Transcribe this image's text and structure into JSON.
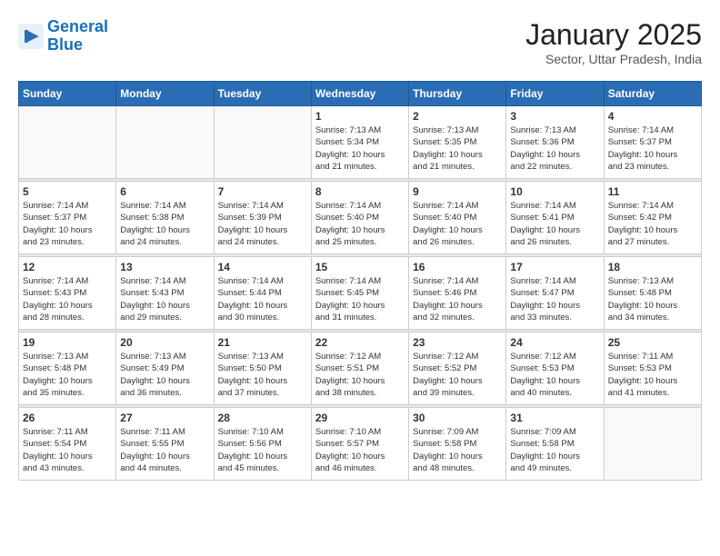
{
  "header": {
    "logo_line1": "General",
    "logo_line2": "Blue",
    "month": "January 2025",
    "location": "Sector, Uttar Pradesh, India"
  },
  "days_of_week": [
    "Sunday",
    "Monday",
    "Tuesday",
    "Wednesday",
    "Thursday",
    "Friday",
    "Saturday"
  ],
  "weeks": [
    [
      {
        "day": "",
        "info": ""
      },
      {
        "day": "",
        "info": ""
      },
      {
        "day": "",
        "info": ""
      },
      {
        "day": "1",
        "info": "Sunrise: 7:13 AM\nSunset: 5:34 PM\nDaylight: 10 hours\nand 21 minutes."
      },
      {
        "day": "2",
        "info": "Sunrise: 7:13 AM\nSunset: 5:35 PM\nDaylight: 10 hours\nand 21 minutes."
      },
      {
        "day": "3",
        "info": "Sunrise: 7:13 AM\nSunset: 5:36 PM\nDaylight: 10 hours\nand 22 minutes."
      },
      {
        "day": "4",
        "info": "Sunrise: 7:14 AM\nSunset: 5:37 PM\nDaylight: 10 hours\nand 23 minutes."
      }
    ],
    [
      {
        "day": "5",
        "info": "Sunrise: 7:14 AM\nSunset: 5:37 PM\nDaylight: 10 hours\nand 23 minutes."
      },
      {
        "day": "6",
        "info": "Sunrise: 7:14 AM\nSunset: 5:38 PM\nDaylight: 10 hours\nand 24 minutes."
      },
      {
        "day": "7",
        "info": "Sunrise: 7:14 AM\nSunset: 5:39 PM\nDaylight: 10 hours\nand 24 minutes."
      },
      {
        "day": "8",
        "info": "Sunrise: 7:14 AM\nSunset: 5:40 PM\nDaylight: 10 hours\nand 25 minutes."
      },
      {
        "day": "9",
        "info": "Sunrise: 7:14 AM\nSunset: 5:40 PM\nDaylight: 10 hours\nand 26 minutes."
      },
      {
        "day": "10",
        "info": "Sunrise: 7:14 AM\nSunset: 5:41 PM\nDaylight: 10 hours\nand 26 minutes."
      },
      {
        "day": "11",
        "info": "Sunrise: 7:14 AM\nSunset: 5:42 PM\nDaylight: 10 hours\nand 27 minutes."
      }
    ],
    [
      {
        "day": "12",
        "info": "Sunrise: 7:14 AM\nSunset: 5:43 PM\nDaylight: 10 hours\nand 28 minutes."
      },
      {
        "day": "13",
        "info": "Sunrise: 7:14 AM\nSunset: 5:43 PM\nDaylight: 10 hours\nand 29 minutes."
      },
      {
        "day": "14",
        "info": "Sunrise: 7:14 AM\nSunset: 5:44 PM\nDaylight: 10 hours\nand 30 minutes."
      },
      {
        "day": "15",
        "info": "Sunrise: 7:14 AM\nSunset: 5:45 PM\nDaylight: 10 hours\nand 31 minutes."
      },
      {
        "day": "16",
        "info": "Sunrise: 7:14 AM\nSunset: 5:46 PM\nDaylight: 10 hours\nand 32 minutes."
      },
      {
        "day": "17",
        "info": "Sunrise: 7:14 AM\nSunset: 5:47 PM\nDaylight: 10 hours\nand 33 minutes."
      },
      {
        "day": "18",
        "info": "Sunrise: 7:13 AM\nSunset: 5:48 PM\nDaylight: 10 hours\nand 34 minutes."
      }
    ],
    [
      {
        "day": "19",
        "info": "Sunrise: 7:13 AM\nSunset: 5:48 PM\nDaylight: 10 hours\nand 35 minutes."
      },
      {
        "day": "20",
        "info": "Sunrise: 7:13 AM\nSunset: 5:49 PM\nDaylight: 10 hours\nand 36 minutes."
      },
      {
        "day": "21",
        "info": "Sunrise: 7:13 AM\nSunset: 5:50 PM\nDaylight: 10 hours\nand 37 minutes."
      },
      {
        "day": "22",
        "info": "Sunrise: 7:12 AM\nSunset: 5:51 PM\nDaylight: 10 hours\nand 38 minutes."
      },
      {
        "day": "23",
        "info": "Sunrise: 7:12 AM\nSunset: 5:52 PM\nDaylight: 10 hours\nand 39 minutes."
      },
      {
        "day": "24",
        "info": "Sunrise: 7:12 AM\nSunset: 5:53 PM\nDaylight: 10 hours\nand 40 minutes."
      },
      {
        "day": "25",
        "info": "Sunrise: 7:11 AM\nSunset: 5:53 PM\nDaylight: 10 hours\nand 41 minutes."
      }
    ],
    [
      {
        "day": "26",
        "info": "Sunrise: 7:11 AM\nSunset: 5:54 PM\nDaylight: 10 hours\nand 43 minutes."
      },
      {
        "day": "27",
        "info": "Sunrise: 7:11 AM\nSunset: 5:55 PM\nDaylight: 10 hours\nand 44 minutes."
      },
      {
        "day": "28",
        "info": "Sunrise: 7:10 AM\nSunset: 5:56 PM\nDaylight: 10 hours\nand 45 minutes."
      },
      {
        "day": "29",
        "info": "Sunrise: 7:10 AM\nSunset: 5:57 PM\nDaylight: 10 hours\nand 46 minutes."
      },
      {
        "day": "30",
        "info": "Sunrise: 7:09 AM\nSunset: 5:58 PM\nDaylight: 10 hours\nand 48 minutes."
      },
      {
        "day": "31",
        "info": "Sunrise: 7:09 AM\nSunset: 5:58 PM\nDaylight: 10 hours\nand 49 minutes."
      },
      {
        "day": "",
        "info": ""
      }
    ]
  ]
}
